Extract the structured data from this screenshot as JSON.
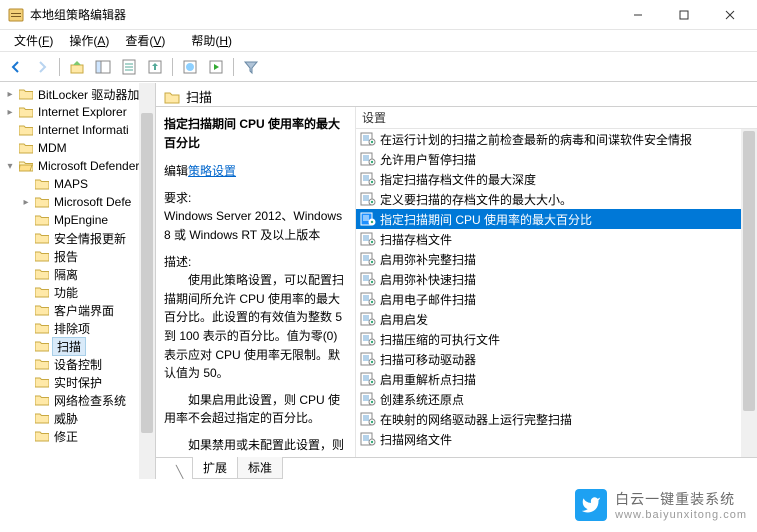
{
  "window": {
    "title": "本地组策略编辑器"
  },
  "menu": {
    "file": "文件(F)",
    "action": "操作(A)",
    "view": "查看(V)",
    "help": "帮助(H)"
  },
  "tree": {
    "items": [
      {
        "label": "BitLocker 驱动器加",
        "level": 0,
        "twisty": ">"
      },
      {
        "label": "Internet Explorer",
        "level": 0,
        "twisty": ">"
      },
      {
        "label": "Internet Informati",
        "level": 0,
        "twisty": ""
      },
      {
        "label": "MDM",
        "level": 0,
        "twisty": ""
      },
      {
        "label": "Microsoft Defender",
        "level": 0,
        "twisty": "v",
        "open": true
      },
      {
        "label": "MAPS",
        "level": 1,
        "twisty": ""
      },
      {
        "label": "Microsoft Defe",
        "level": 1,
        "twisty": ">"
      },
      {
        "label": "MpEngine",
        "level": 1,
        "twisty": ""
      },
      {
        "label": "安全情报更新",
        "level": 1,
        "twisty": ""
      },
      {
        "label": "报告",
        "level": 1,
        "twisty": ""
      },
      {
        "label": "隔离",
        "level": 1,
        "twisty": ""
      },
      {
        "label": "功能",
        "level": 1,
        "twisty": ""
      },
      {
        "label": "客户端界面",
        "level": 1,
        "twisty": ""
      },
      {
        "label": "排除项",
        "level": 1,
        "twisty": ""
      },
      {
        "label": "扫描",
        "level": 1,
        "twisty": "",
        "selected": true
      },
      {
        "label": "设备控制",
        "level": 1,
        "twisty": ""
      },
      {
        "label": "实时保护",
        "level": 1,
        "twisty": ""
      },
      {
        "label": "网络检查系统",
        "level": 1,
        "twisty": ""
      },
      {
        "label": "威胁",
        "level": 1,
        "twisty": ""
      },
      {
        "label": "修正",
        "level": 1,
        "twisty": ""
      }
    ]
  },
  "right": {
    "header": "扫描",
    "detail": {
      "title": "指定扫描期间 CPU 使用率的最大百分比",
      "editLabel": "编辑",
      "linkText": "策略设置",
      "reqLabel": "要求:",
      "reqText": "Windows Server 2012、Windows 8 或 Windows RT 及以上版本",
      "descLabel": "描述:",
      "p1": "　　使用此策略设置，可以配置扫描期间所允许 CPU 使用率的最大百分比。此设置的有效值为整数 5 到 100 表示的百分比。值为零(0)表示应对 CPU 使用率无限制。默认值为 50。",
      "p2": "　　如果启用此设置，则 CPU 使用率不会超过指定的百分比。",
      "p3": "　　如果禁用或未配置此设置，则 CPU 使用率不会超过默认值。"
    },
    "listHeader": "设置",
    "items": [
      "在运行计划的扫描之前检查最新的病毒和间谍软件安全情报",
      "允许用户暂停扫描",
      "指定扫描存档文件的最大深度",
      "定义要扫描的存档文件的最大大小。",
      "指定扫描期间 CPU 使用率的最大百分比",
      "扫描存档文件",
      "启用弥补完整扫描",
      "启用弥补快速扫描",
      "启用电子邮件扫描",
      "启用启发",
      "扫描压缩的可执行文件",
      "扫描可移动驱动器",
      "启用重解析点扫描",
      "创建系统还原点",
      "在映射的网络驱动器上运行完整扫描",
      "扫描网络文件"
    ],
    "selectedIndex": 4
  },
  "tabs": {
    "extended": "扩展",
    "standard": "标准"
  },
  "watermark": {
    "text": "白云一键重装系统",
    "url": "www.baiyunxitong.com"
  }
}
